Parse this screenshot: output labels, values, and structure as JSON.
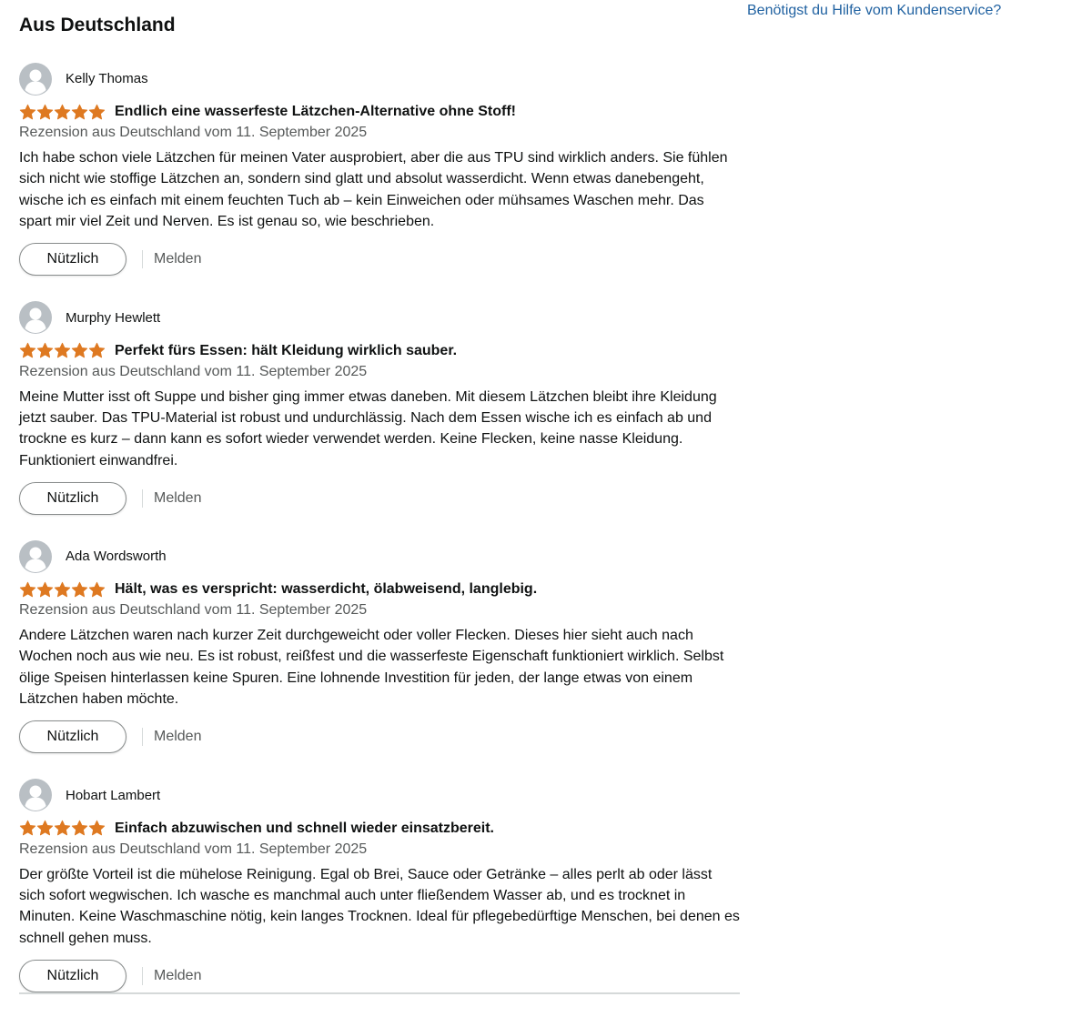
{
  "section": {
    "title": "Aus Deutschland",
    "help_link": "Benötigst du Hilfe vom Kundenservice?"
  },
  "colors": {
    "star": "#de7921",
    "link": "#2162a1",
    "meta": "#565959"
  },
  "reviews": [
    {
      "name": "Kelly Thomas",
      "rating": 5,
      "title": "Endlich eine wasserfeste Lätzchen-Alternative ohne Stoff!",
      "meta": "Rezension aus Deutschland vom 11. September 2025",
      "body": "Ich habe schon viele Lätzchen für meinen Vater ausprobiert, aber die aus TPU sind wirklich anders. Sie fühlen sich nicht wie stoffige Lätzchen an, sondern sind glatt und absolut wasserdicht. Wenn etwas danebengeht, wische ich es einfach mit einem feuchten Tuch ab – kein Einweichen oder mühsames Waschen mehr. Das spart mir viel Zeit und Nerven. Es ist genau so, wie beschrieben.",
      "helpful_label": "Nützlich",
      "report_label": "Melden"
    },
    {
      "name": "Murphy Hewlett",
      "rating": 5,
      "title": "Perfekt fürs Essen: hält Kleidung wirklich sauber.",
      "meta": "Rezension aus Deutschland vom 11. September 2025",
      "body": "Meine Mutter isst oft Suppe und bisher ging immer etwas daneben. Mit diesem Lätzchen bleibt ihre Kleidung jetzt sauber. Das TPU-Material ist robust und undurchlässig. Nach dem Essen wische ich es einfach ab und trockne es kurz – dann kann es sofort wieder verwendet werden. Keine Flecken, keine nasse Kleidung. Funktioniert einwandfrei.",
      "helpful_label": "Nützlich",
      "report_label": "Melden"
    },
    {
      "name": "Ada Wordsworth",
      "rating": 5,
      "title": "Hält, was es verspricht: wasserdicht, ölabweisend, langlebig.",
      "meta": "Rezension aus Deutschland vom 11. September 2025",
      "body": "Andere Lätzchen waren nach kurzer Zeit durchgeweicht oder voller Flecken. Dieses hier sieht auch nach Wochen noch aus wie neu. Es ist robust, reißfest und die wasserfeste Eigenschaft funktioniert wirklich. Selbst ölige Speisen hinterlassen keine Spuren. Eine lohnende Investition für jeden, der lange etwas von einem Lätzchen haben möchte.",
      "helpful_label": "Nützlich",
      "report_label": "Melden"
    },
    {
      "name": "Hobart Lambert",
      "rating": 5,
      "title": "Einfach abzuwischen und schnell wieder einsatzbereit.",
      "meta": "Rezension aus Deutschland vom 11. September 2025",
      "body": "Der größte Vorteil ist die mühelose Reinigung. Egal ob Brei, Sauce oder Getränke – alles perlt ab oder lässt sich sofort wegwischen. Ich wasche es manchmal auch unter fließendem Wasser ab, und es trocknet in Minuten. Keine Waschmaschine nötig, kein langes Trocknen. Ideal für pflegebedürftige Menschen, bei denen es schnell gehen muss.",
      "helpful_label": "Nützlich",
      "report_label": "Melden"
    }
  ]
}
